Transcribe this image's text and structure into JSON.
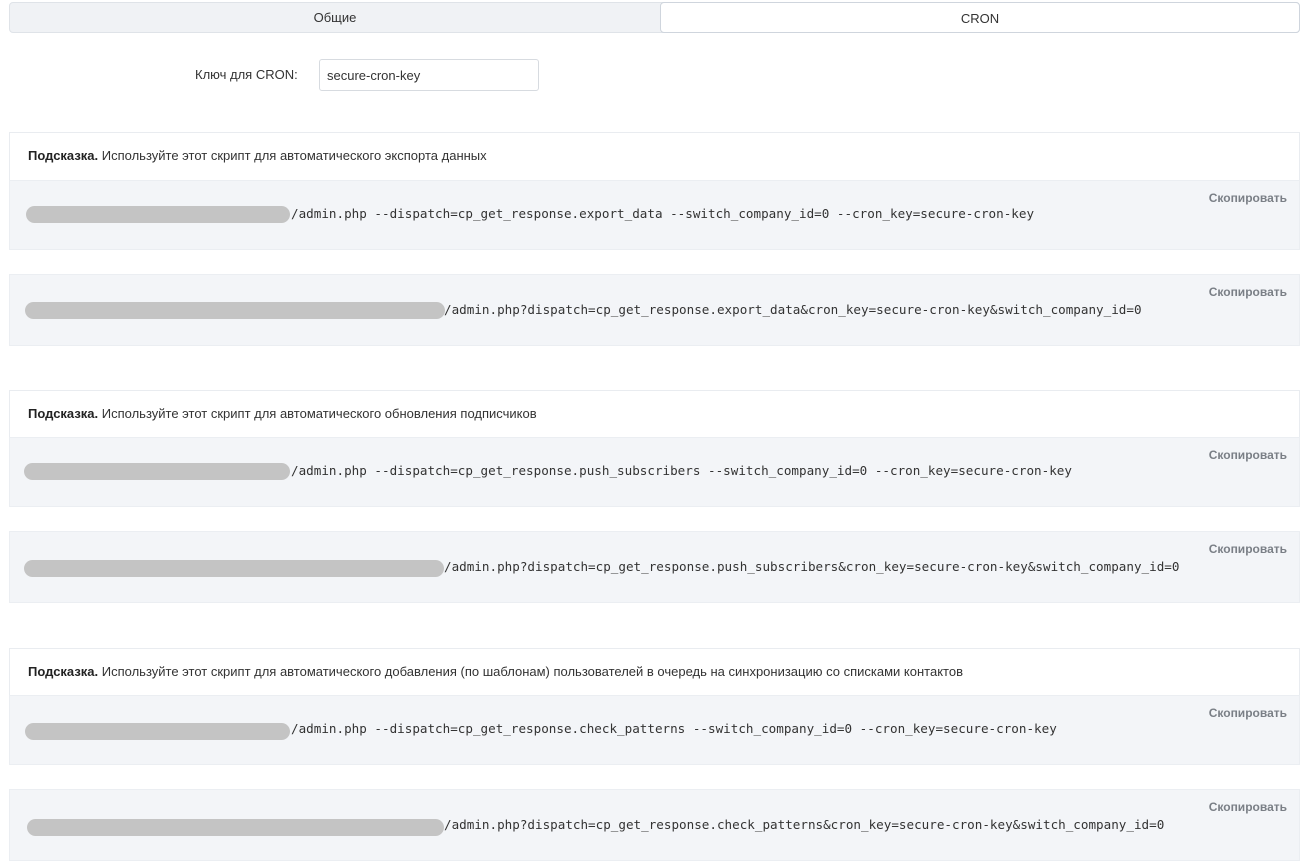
{
  "tabs": {
    "general": "Общие",
    "cron": "CRON"
  },
  "cron_key": {
    "label": "Ключ для CRON:",
    "value": "secure-cron-key"
  },
  "copy_label": "Скопировать",
  "hint_prefix": "Подсказка.",
  "sections": [
    {
      "hint": "Используйте этот скрипт для автоматического экспорта данных",
      "cli_command": "/admin.php --dispatch=cp_get_response.export_data --switch_company_id=0 --cron_key=secure-cron-key",
      "url_command": "/admin.php?dispatch=cp_get_response.export_data&cron_key=secure-cron-key&switch_company_id=0"
    },
    {
      "hint": "Используйте этот скрипт для автоматического обновления подписчиков",
      "cli_command": "/admin.php --dispatch=cp_get_response.push_subscribers --switch_company_id=0 --cron_key=secure-cron-key",
      "url_command": "/admin.php?dispatch=cp_get_response.push_subscribers&cron_key=secure-cron-key&switch_company_id=0"
    },
    {
      "hint": "Используйте этот скрипт для автоматического добавления (по шаблонам) пользователей в очередь на синхронизацию со списками контактов",
      "cli_command": "/admin.php --dispatch=cp_get_response.check_patterns --switch_company_id=0 --cron_key=secure-cron-key",
      "url_command": "/admin.php?dispatch=cp_get_response.check_patterns&cron_key=secure-cron-key&switch_company_id=0"
    }
  ]
}
